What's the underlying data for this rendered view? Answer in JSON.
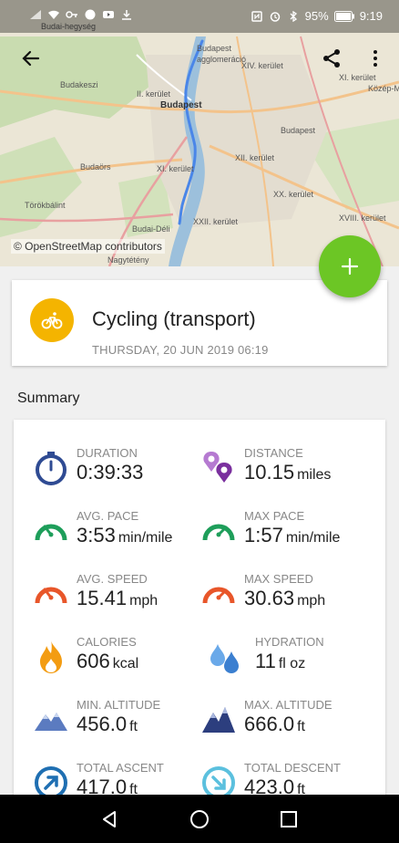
{
  "status_bar": {
    "battery": "95%",
    "time": "9:19"
  },
  "map": {
    "attribution": "© OpenStreetMap contributors",
    "labels": {
      "budai_hegyseg": "Budai-hegység",
      "budapest_top": "Budapest",
      "agglomeracio": "agglomeráció",
      "xiv": "XIV. kerület",
      "xi_top": "XI. kerület",
      "kozep_ma": "Közép-Ma",
      "budakeszi": "Budakeszi",
      "ii": "II. kerület",
      "budapest_center": "Budapest",
      "budapest_right": "Budapest",
      "budaors": "Budaörs",
      "xi": "XI. kerület",
      "xii": "XII. kerület",
      "torokbalint": "Törökbálint",
      "xx": "XX. kerület",
      "budai_deli": "Budai-Déli",
      "xxii": "XXII. kerület",
      "xviii": "XVIII. kerület",
      "nagyteteny": "Nagytétény"
    }
  },
  "header": {
    "sport_icon": "bicycle-icon",
    "title": "Cycling (transport)",
    "date": "THURSDAY, 20 JUN 2019 06:19"
  },
  "summary": {
    "title": "Summary",
    "stats": [
      {
        "key": "duration",
        "label": "DURATION",
        "value": "0:39:33",
        "unit": "",
        "icon": "stopwatch-icon",
        "color": "#2f4b93"
      },
      {
        "key": "distance",
        "label": "DISTANCE",
        "value": "10.15",
        "unit": "miles",
        "icon": "location-pins-icon",
        "color": "#8e44ad"
      },
      {
        "key": "avg_pace",
        "label": "AVG. PACE",
        "value": "3:53",
        "unit": "min/mile",
        "icon": "gauge-green-icon",
        "color": "#1e9e5a"
      },
      {
        "key": "max_pace",
        "label": "MAX PACE",
        "value": "1:57",
        "unit": "min/mile",
        "icon": "gauge-green-icon",
        "color": "#1e9e5a"
      },
      {
        "key": "avg_speed",
        "label": "AVG. SPEED",
        "value": "15.41",
        "unit": "mph",
        "icon": "gauge-orange-icon",
        "color": "#e8562a"
      },
      {
        "key": "max_speed",
        "label": "MAX SPEED",
        "value": "30.63",
        "unit": "mph",
        "icon": "gauge-orange-icon",
        "color": "#e8562a"
      },
      {
        "key": "calories",
        "label": "CALORIES",
        "value": "606",
        "unit": "kcal",
        "icon": "flame-icon",
        "color": "#f39c12"
      },
      {
        "key": "hydration",
        "label": "HYDRATION",
        "value": "11",
        "unit": "fl oz",
        "icon": "water-drops-icon",
        "color": "#4a90e2"
      },
      {
        "key": "min_altitude",
        "label": "MIN. ALTITUDE",
        "value": "456.0",
        "unit": "ft",
        "icon": "mountain-light-icon",
        "color": "#5b7bc0"
      },
      {
        "key": "max_altitude",
        "label": "MAX. ALTITUDE",
        "value": "666.0",
        "unit": "ft",
        "icon": "mountain-dark-icon",
        "color": "#2c3e7e"
      },
      {
        "key": "total_ascent",
        "label": "TOTAL ASCENT",
        "value": "417.0",
        "unit": "ft",
        "icon": "arrow-up-right-circle-icon",
        "color": "#1f6fb2"
      },
      {
        "key": "total_descent",
        "label": "TOTAL DESCENT",
        "value": "423.0",
        "unit": "ft",
        "icon": "arrow-down-right-circle-icon",
        "color": "#5bc0de"
      }
    ]
  },
  "colors": {
    "accent_green": "#6cc625",
    "sport_yellow": "#f4b400",
    "route_blue": "#4a86e8"
  }
}
